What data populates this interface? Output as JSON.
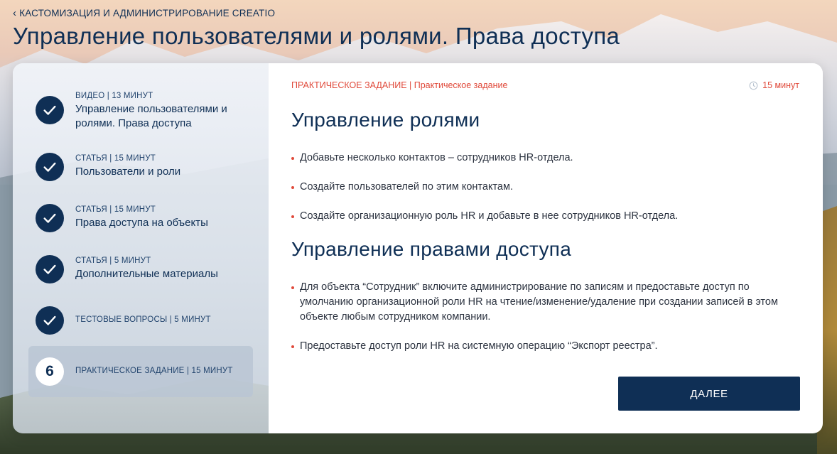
{
  "header": {
    "back_label": "КАСТОМИЗАЦИЯ И АДМИНИСТРИРОВАНИЕ CREATIO",
    "page_title": "Управление пользователями и ролями. Права доступа"
  },
  "steps": [
    {
      "kind": "ВИДЕО | 13 МИНУТ",
      "name": "Управление пользователями и ролями. Права доступа",
      "state": "completed",
      "icon": "check-icon"
    },
    {
      "kind": "СТАТЬЯ | 15 МИНУТ",
      "name": "Пользователи и роли",
      "state": "completed",
      "icon": "check-icon"
    },
    {
      "kind": "СТАТЬЯ | 15 МИНУТ",
      "name": "Права доступа на объекты",
      "state": "completed",
      "icon": "check-icon"
    },
    {
      "kind": "СТАТЬЯ | 5 МИНУТ",
      "name": "Дополнительные материалы",
      "state": "completed",
      "icon": "check-icon"
    },
    {
      "kind": "ТЕСТОВЫЕ ВОПРОСЫ | 5 МИНУТ",
      "name": "",
      "state": "completed",
      "icon": "check-icon"
    },
    {
      "kind": "ПРАКТИЧЕСКОЕ ЗАДАНИЕ | 15 МИНУТ",
      "name": "",
      "state": "active",
      "number": "6"
    }
  ],
  "content": {
    "crumb": "ПРАКТИЧЕСКОЕ ЗАДАНИЕ | Практическое задание",
    "duration": "15 минут",
    "section1": {
      "title": "Управление ролями",
      "items": [
        "Добавьте несколько контактов – сотрудников HR-отдела.",
        "Создайте пользователей по этим контактам.",
        "Создайте организационную роль HR и добавьте в нее сотрудников HR-отдела."
      ]
    },
    "section2": {
      "title": "Управление правами доступа",
      "items": [
        "Для объекта “Сотрудник” включите администрирование по записям и предоставьте доступ по умолчанию организационной роли HR на чтение/изменение/удаление при создании записей в этом объекте любым сотрудником компании.",
        "Предоставьте доступ роли HR на системную операцию “Экспорт реестра”."
      ]
    },
    "next_label": "ДАЛЕЕ"
  },
  "colors": {
    "navy": "#0f2f55",
    "accent_red": "#e0493a",
    "text": "#2c3340"
  }
}
